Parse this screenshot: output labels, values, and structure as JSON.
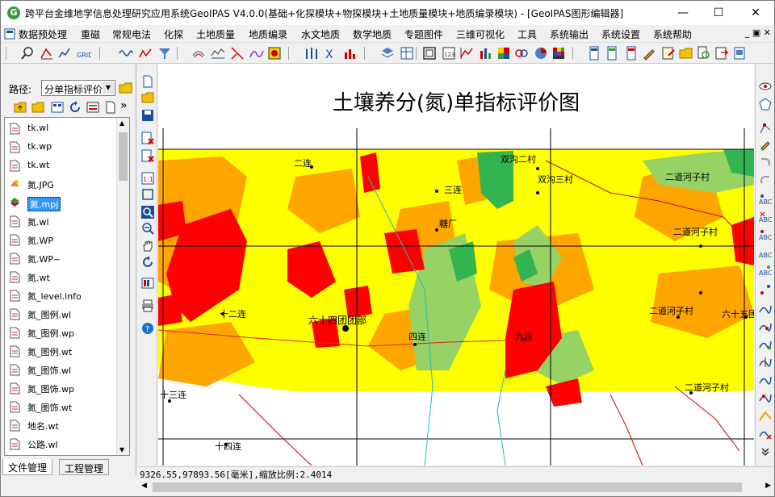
{
  "window": {
    "title": "跨平台金维地学信息处理研究应用系统GeoIPAS V4.0.0(基础+化探模块+物探模块+土地质量模块+地质编录模块) - [GeoIPAS图形编辑器]",
    "icon_letter": "G",
    "minimize": "—",
    "maximize": "☐",
    "close": "✕"
  },
  "menu": {
    "items": [
      "数据预处理",
      "重磁",
      "常规电法",
      "化探",
      "土地质量",
      "地质编录",
      "水文地质",
      "数学地质",
      "专题图件",
      "三维可视化",
      "工具",
      "系统输出",
      "系统设置",
      "系统帮助"
    ],
    "mdi_buttons": "_ ▣ ✕"
  },
  "left_panel": {
    "path_label": "路径:",
    "path_value": "分单指标评价",
    "files": [
      {
        "name": "tk.wl",
        "icon": "doc-icon"
      },
      {
        "name": "tk.wp",
        "icon": "doc-icon"
      },
      {
        "name": "tk.wt",
        "icon": "doc-icon"
      },
      {
        "name": "氮.JPG",
        "icon": "image-icon"
      },
      {
        "name": "氮.mpj",
        "icon": "project-icon",
        "selected": true
      },
      {
        "name": "氮.wl",
        "icon": "doc-icon"
      },
      {
        "name": "氮.WP",
        "icon": "doc-icon"
      },
      {
        "name": "氮.WP~",
        "icon": "doc-icon"
      },
      {
        "name": "氮.wt",
        "icon": "doc-icon"
      },
      {
        "name": "氮_level.info",
        "icon": "doc-icon"
      },
      {
        "name": "氮_图例.wl",
        "icon": "doc-icon"
      },
      {
        "name": "氮_图例.wp",
        "icon": "doc-icon"
      },
      {
        "name": "氮_图例.wt",
        "icon": "doc-icon"
      },
      {
        "name": "氮_图饰.wl",
        "icon": "doc-icon"
      },
      {
        "name": "氮_图饰.wp",
        "icon": "doc-icon"
      },
      {
        "name": "氮_图饰.wt",
        "icon": "doc-icon"
      },
      {
        "name": "地名.wt",
        "icon": "doc-icon"
      },
      {
        "name": "公路.wl",
        "icon": "doc-icon"
      }
    ],
    "tabs": [
      "文件管理",
      "工程管理"
    ]
  },
  "map": {
    "title": "土壤养分(氮)单指标评价图",
    "places": [
      "二连",
      "双沟二村",
      "双沟三村",
      "三连",
      "二道河子村",
      "糖厂",
      "二道河子村",
      "十二连",
      "六十四团团部",
      "四连",
      "九连",
      "二道河子村",
      "六十五团",
      "十三连",
      "二道河子村",
      "十四连"
    ],
    "colors": {
      "red": "#ff0000",
      "orange": "#ffa500",
      "yellow": "#ffff00",
      "lightgreen": "#96d264",
      "green": "#32b450",
      "white": "#ffffff"
    }
  },
  "status": {
    "text": "9326.55,97893.56[毫米],缩放比例:2.4014"
  }
}
